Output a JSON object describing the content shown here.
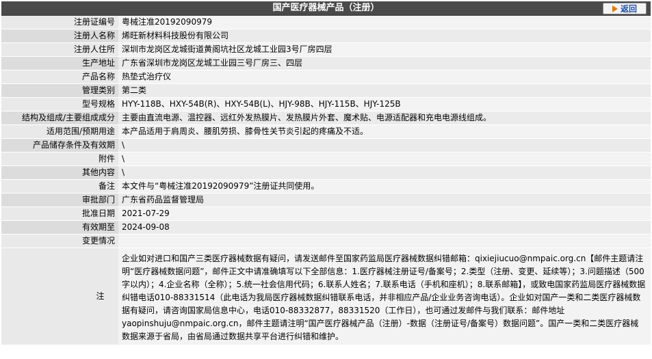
{
  "header": {
    "title": "国产医疗器械产品（注册）",
    "back_label": "返回"
  },
  "fields": [
    {
      "label": "注册证编号",
      "value": "粤械注准20192090979"
    },
    {
      "label": "注册人名称",
      "value": "烯旺新材料科技股份有限公司"
    },
    {
      "label": "注册人住所",
      "value": "深圳市龙岗区龙城街道黄阁坑社区龙城工业园3号厂房四层"
    },
    {
      "label": "生产地址",
      "value": "广东省深圳市龙岗区龙城工业园三号厂房三、四层"
    },
    {
      "label": "产品名称",
      "value": "热垫式治疗仪"
    },
    {
      "label": "管理类别",
      "value": "第二类"
    },
    {
      "label": "型号规格",
      "value": "HYY-118B、HXY-54B(R)、HXY-54B(L)、HJY-98B、HJY-115B、HJY-125B"
    },
    {
      "label": "结构及组成/主要组成成分",
      "value": "主要由直流电源、温控器、远红外发热膜片、发热膜片外套、魔术贴、电源适配器和充电电源线组成。"
    },
    {
      "label": "适用范围/预期用途",
      "value": "本产品适用于肩周炎、腰肌劳损、膝骨性关节炎引起的疼痛及不适。"
    },
    {
      "label": "产品储存条件及有效期",
      "value": "\\"
    },
    {
      "label": "附件",
      "value": "\\"
    },
    {
      "label": "其他内容",
      "value": "\\"
    },
    {
      "label": "备注",
      "value": "本文件与“粤械注准20192090979”注册证共同使用。"
    },
    {
      "label": "审批部门",
      "value": "广东省药品监督管理局"
    },
    {
      "label": "批准日期",
      "value": "2021-07-29"
    },
    {
      "label": "有效期至",
      "value": "2024-09-08"
    },
    {
      "label": "变更情况",
      "value": ""
    }
  ],
  "note": {
    "label": "注",
    "text": "企业如对进口和国产三类医疗器械数据有疑问，请发送邮件至国家药监局医疗器械数据纠错邮箱：qixiejiucuo@nmpaic.org.cn【邮件主题请注明“医疗器械数据问题”，邮件正文中请准确填写以下全部信息：1.医疗器械注册证号/备案号；2.类型（注册、变更、延续等）；3.问题描述（500字以内）；4.企业名称（全称）；5.统一社会信用代码；6.联系人姓名；7.联系电话（手机和座机）；8.联系邮箱】，或致电国家药监局医疗器械数据纠错电话010-88331514（此电话为我局医疗器械数据纠错联系电话，并非相应产品/企业业务咨询电话）。企业如对国产一类和二类医疗器械数据有疑问，请咨询国家局信息中心，电话010-88332877，88331520（工作日），也可通过发邮件与我们联系：邮件地址yaopinshuju@nmpaic.org.cn，邮件主题请注明“国产医疗器械产品（注册）-数据（注册证号/备案号）数据问题”。国产一类和二类医疗器械数据来源于省局，由省局通过数据共享平台进行纠错和维护。"
  }
}
